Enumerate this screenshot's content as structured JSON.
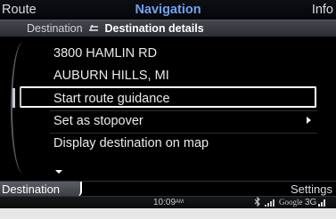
{
  "header": {
    "left_tab": "Route",
    "title": "Navigation",
    "right_tab": "Info"
  },
  "breadcrumb": {
    "parent": "Destination",
    "current": "Destination details"
  },
  "destination": {
    "street": "3800 HAMLIN RD",
    "city": "AUBURN HILLS, MI"
  },
  "menu": {
    "items": [
      {
        "label": "Start route guidance",
        "selected": true
      },
      {
        "label": "Set as stopover",
        "has_submenu": true
      },
      {
        "label": "Display destination on map",
        "more_below": true
      }
    ]
  },
  "bottom_bar": {
    "left_softkey": "Destination",
    "right_softkey": "Settings"
  },
  "status_bar": {
    "time": "10:09",
    "ampm": "AM",
    "provider": "Google",
    "network": "3G"
  },
  "colors": {
    "title_accent": "#6fa2f2",
    "background": "#000000",
    "selection_border": "#ffffff"
  },
  "icons": [
    "breadcrumb-back-arrow-icon",
    "submenu-arrow-icon",
    "scroll-down-icon",
    "bluetooth-icon",
    "signal-strength-icon"
  ]
}
